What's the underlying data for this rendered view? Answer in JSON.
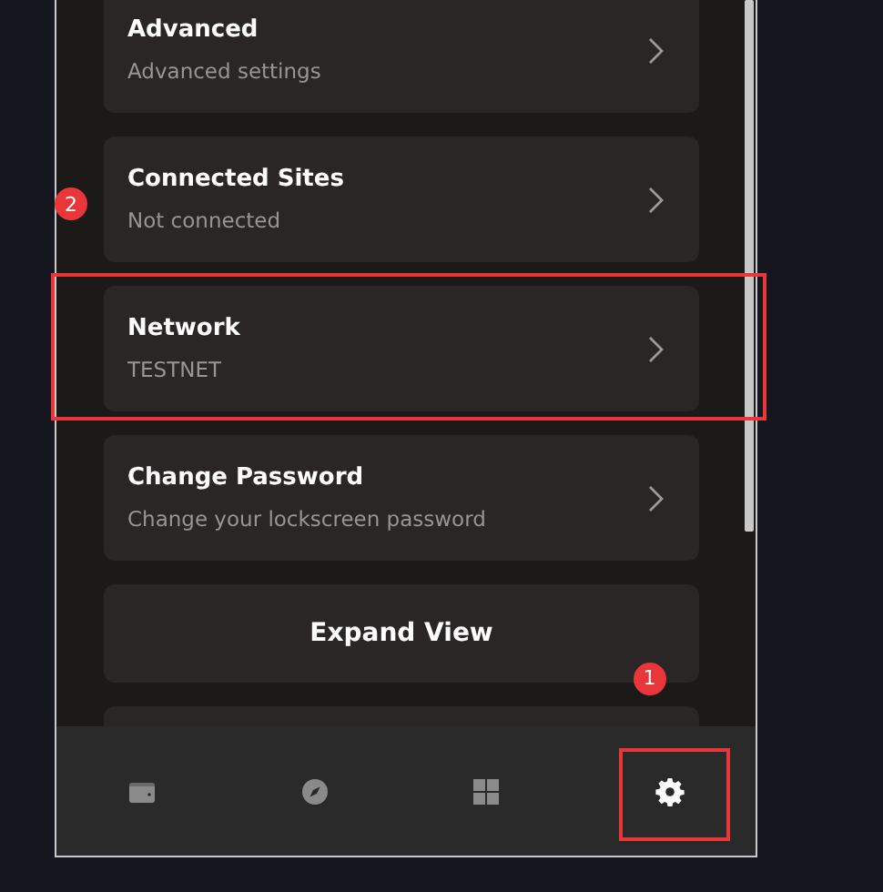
{
  "settings": [
    {
      "title": "Advanced",
      "subtitle": "Advanced settings",
      "highlighted": false
    },
    {
      "title": "Connected Sites",
      "subtitle": "Not connected",
      "highlighted": false,
      "callout": "2"
    },
    {
      "title": "Network",
      "subtitle": "TESTNET",
      "highlighted": true
    },
    {
      "title": "Change Password",
      "subtitle": "Change your lockscreen password",
      "highlighted": false
    }
  ],
  "expand_button": {
    "label": "Expand View"
  },
  "nav": {
    "tabs": [
      {
        "kind": "wallet",
        "selected": false,
        "highlighted": false
      },
      {
        "kind": "explore",
        "selected": false,
        "highlighted": false
      },
      {
        "kind": "apps",
        "selected": false,
        "highlighted": false
      },
      {
        "kind": "settings",
        "selected": true,
        "highlighted": true,
        "callout": "1"
      }
    ]
  }
}
